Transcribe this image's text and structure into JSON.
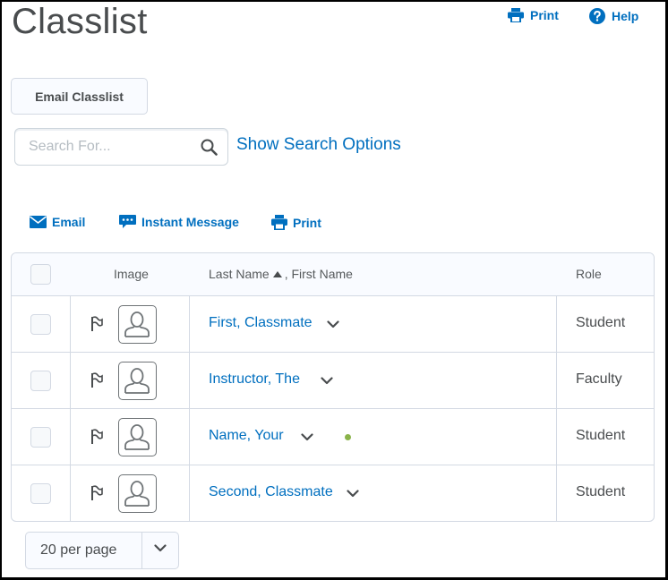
{
  "page": {
    "title": "Classlist"
  },
  "top_links": {
    "print": "Print",
    "help": "Help"
  },
  "toolbar": {
    "email_classlist": "Email Classlist"
  },
  "search": {
    "placeholder": "Search For...",
    "value": "",
    "show_options": "Show Search Options"
  },
  "actions": {
    "email": "Email",
    "instant_message": "Instant Message",
    "print": "Print"
  },
  "table": {
    "headers": {
      "image": "Image",
      "last_name": "Last Name",
      "name_sep": ", First Name",
      "role": "Role"
    },
    "rows": [
      {
        "name": "First, Classmate",
        "role": "Student",
        "online": false
      },
      {
        "name": "Instructor, The",
        "role": "Faculty",
        "online": false
      },
      {
        "name": "Name, Your",
        "role": "Student",
        "online": true
      },
      {
        "name": "Second, Classmate",
        "role": "Student",
        "online": false
      }
    ]
  },
  "pager": {
    "selected": "20 per page"
  },
  "colors": {
    "link": "#006fbf",
    "online": "#8ab34a",
    "border": "#d3d9e3",
    "text": "#494c4e"
  }
}
